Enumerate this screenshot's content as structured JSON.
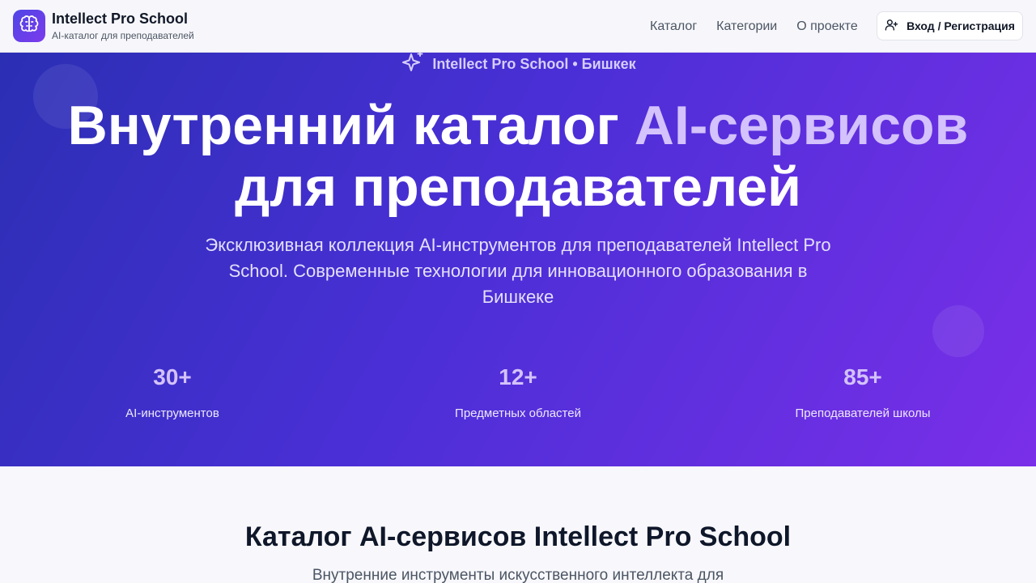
{
  "header": {
    "brand_title": "Intellect Pro School",
    "brand_subtitle": "AI-каталог для преподавателей",
    "logo_icon": "brain-icon",
    "nav": [
      "Каталог",
      "Категории",
      "О проекте"
    ],
    "login_label": "Вход / Регистрация",
    "login_icon": "user-plus-icon"
  },
  "hero": {
    "badge": "Intellect Pro School • Бишкек",
    "badge_icon": "sparkles-icon",
    "title_part1": "Внутренний каталог",
    "title_accent": "AI-сервисов",
    "title_line2": "для преподавателей",
    "description": "Эксклюзивная коллекция AI-инструментов для преподавателей Intellect Pro School. Современные технологии для инновационного образования в Бишкеке",
    "stats": [
      {
        "value": "30+",
        "label": "AI-инструментов"
      },
      {
        "value": "12+",
        "label": "Предметных областей"
      },
      {
        "value": "85+",
        "label": "Преподавателей школы"
      }
    ]
  },
  "catalog": {
    "title": "Каталог AI-сервисов Intellect Pro School",
    "subtitle": "Внутренние инструменты искусственного интеллекта для"
  },
  "colors": {
    "accent": "#7c3aed",
    "hero_gradient_start": "#2b2fb4",
    "hero_gradient_end": "#7a2fe8",
    "accent_text": "#d3c2fb"
  }
}
